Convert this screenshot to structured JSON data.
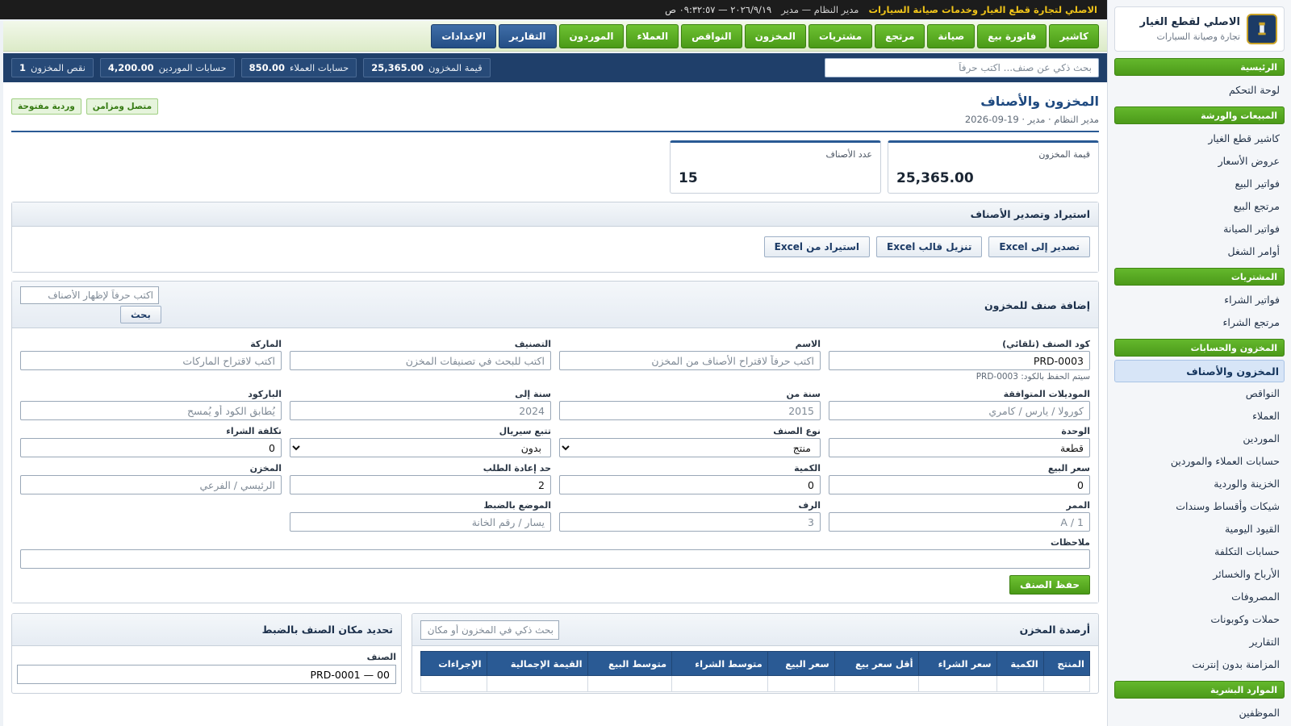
{
  "brand": {
    "title": "الاصلي لقطع الغيار",
    "subtitle": "تجارة وصيانة السيارات"
  },
  "sidebar": {
    "sections": [
      {
        "title": "الرئيسية",
        "items": [
          "لوحة التحكم"
        ]
      },
      {
        "title": "المبيعات والورشة",
        "items": [
          "كاشير قطع الغيار",
          "عروض الأسعار",
          "فواتير البيع",
          "مرتجع البيع",
          "فواتير الصيانة",
          "أوامر الشغل"
        ]
      },
      {
        "title": "المشتريات",
        "items": [
          "فواتير الشراء",
          "مرتجع الشراء"
        ]
      },
      {
        "title": "المخزون والحسابات",
        "items": [
          "المخزون والأصناف",
          "النواقص",
          "العملاء",
          "الموردين",
          "حسابات العملاء والموردين",
          "الخزينة والوردية",
          "شيكات وأقساط وسندات",
          "القيود اليومية",
          "حسابات التكلفة",
          "الأرباح والخسائر",
          "المصروفات",
          "حملات وكوبونات",
          "التقارير",
          "المزامنة بدون إنترنت"
        ]
      },
      {
        "title": "الموارد البشرية",
        "items": [
          "الموظفين"
        ]
      }
    ],
    "active_item": "المخزون والأصناف"
  },
  "topbar": {
    "company": "الاصلي لتجارة قطع الغيار وخدمات صيانة السيارات",
    "user": "مدير النظام — مدير",
    "datetime": "٢٠٢٦/٩/١٩ — ٠٩:٣٢:٥٧ ص"
  },
  "nav": [
    {
      "label": "كاشير",
      "style": "green"
    },
    {
      "label": "فاتورة بيع",
      "style": "green"
    },
    {
      "label": "صيانة",
      "style": "green"
    },
    {
      "label": "مرتجع",
      "style": "green"
    },
    {
      "label": "مشتريات",
      "style": "green"
    },
    {
      "label": "المخزون",
      "style": "green"
    },
    {
      "label": "النواقص",
      "style": "green"
    },
    {
      "label": "العملاء",
      "style": "green"
    },
    {
      "label": "الموردون",
      "style": "green"
    },
    {
      "label": "التقارير",
      "style": "blue"
    },
    {
      "label": "الإعدادات",
      "style": "blue"
    }
  ],
  "statsbar": {
    "search_placeholder": "بحث ذكي عن صنف... اكتب حرفاً",
    "chips": [
      {
        "label": "قيمة المخزون",
        "value": "25,365.00"
      },
      {
        "label": "حسابات العملاء",
        "value": "850.00"
      },
      {
        "label": "حسابات الموردين",
        "value": "4,200.00"
      },
      {
        "label": "نقص المخزون",
        "value": "1"
      }
    ]
  },
  "page": {
    "title": "المخزون والأصناف",
    "meta": "مدير النظام · مدير · 19-09-2026",
    "badges": [
      "متصل ومزامن",
      "وردية مفتوحة"
    ]
  },
  "kpis": [
    {
      "label": "قيمة المخزون",
      "value": "25,365.00"
    },
    {
      "label": "عدد الأصناف",
      "value": "15"
    }
  ],
  "import_export": {
    "title": "استيراد وتصدير الأصناف",
    "buttons": [
      "تصدير إلى Excel",
      "تنزيل قالب Excel",
      "استيراد من Excel"
    ]
  },
  "add_item": {
    "title": "إضافة صنف للمخزون",
    "search_placeholder": "اكتب حرفاً لإظهار الأصناف",
    "search_button": "بحث",
    "code_label": "كود الصنف (تلقائي)",
    "code_value": "PRD-0003",
    "code_hint": "سيتم الحفظ بالكود: PRD-0003",
    "name_label": "الاسم",
    "name_placeholder": "اكتب حرفاً لاقتراح الأصناف من المخزن",
    "category_label": "التصنيف",
    "category_placeholder": "اكتب للبحث في تصنيفات المخزن",
    "brand_label": "الماركة",
    "brand_placeholder": "اكتب لاقتراح الماركات",
    "models_label": "الموديلات المتوافقة",
    "models_placeholder": "كورولا / يارس / كامري",
    "year_from_label": "سنة من",
    "year_from_placeholder": "2015",
    "year_to_label": "سنة إلى",
    "year_to_placeholder": "2024",
    "barcode_label": "الباركود",
    "barcode_placeholder": "يُطابق الكود أو يُمسح",
    "unit_label": "الوحدة",
    "unit_value": "قطعة",
    "type_label": "نوع الصنف",
    "type_value": "منتج",
    "serial_label": "تتبع سيريال",
    "serial_value": "بدون",
    "cost_label": "تكلفة الشراء",
    "cost_value": "0",
    "price_label": "سعر البيع",
    "price_value": "0",
    "qty_label": "الكمية",
    "qty_value": "0",
    "reorder_label": "حد إعادة الطلب",
    "reorder_value": "2",
    "store_label": "المخزن",
    "store_placeholder": "الرئيسي / الفرعي",
    "aisle_label": "الممر",
    "aisle_placeholder": "A / 1",
    "shelf_label": "الرف",
    "shelf_placeholder": "3",
    "position_label": "الموضع بالضبط",
    "position_placeholder": "يسار / رقم الخانة",
    "notes_label": "ملاحظات",
    "save_button": "حفظ الصنف"
  },
  "stock": {
    "title": "أرصدة المخزن",
    "search_placeholder": "بحث ذكي في المخزون أو مكان",
    "columns": [
      "المنتج",
      "الكمية",
      "سعر الشراء",
      "أقل سعر بيع",
      "سعر البيع",
      "متوسط الشراء",
      "متوسط البيع",
      "القيمة الإجمالية",
      "الإجراءات"
    ]
  },
  "location": {
    "title": "تحديد مكان الصنف بالضبط",
    "item_label": "الصنف",
    "item_value": "PRD-0001 — 00"
  }
}
